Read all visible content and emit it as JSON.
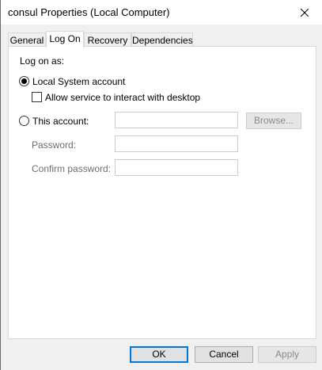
{
  "window": {
    "title": "consul Properties (Local Computer)"
  },
  "tabs": [
    {
      "label": "General"
    },
    {
      "label": "Log On"
    },
    {
      "label": "Recovery"
    },
    {
      "label": "Dependencies"
    }
  ],
  "logon": {
    "heading": "Log on as:",
    "local_system_label": "Local System account",
    "allow_interact_label": "Allow service to interact with desktop",
    "this_account_label": "This account:",
    "browse_label": "Browse...",
    "password_label": "Password:",
    "confirm_password_label": "Confirm password:",
    "selected": "Local System account",
    "allow_interact_checked": false
  },
  "buttons": {
    "ok": "OK",
    "cancel": "Cancel",
    "apply": "Apply"
  },
  "icons": {
    "close": "close-icon"
  },
  "colors": {
    "accent": "#0078d7",
    "titlebar": "#ffffff",
    "dialog_bg": "#f0f0f0"
  }
}
